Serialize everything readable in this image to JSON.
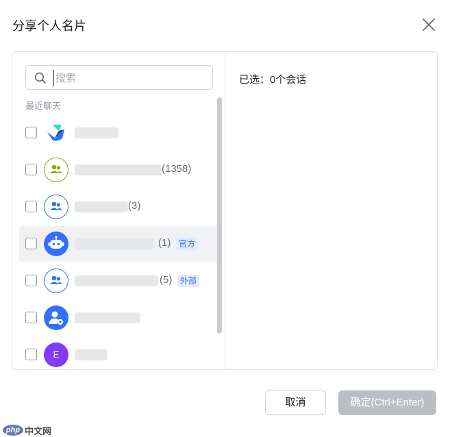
{
  "dialog": {
    "title": "分享个人名片",
    "close_icon": "close-icon"
  },
  "search": {
    "placeholder": "搜索",
    "value": "",
    "icon": "search-icon"
  },
  "recent": {
    "section_label": "最近聊天",
    "items": [
      {
        "avatar_icon": "app-logo-icon",
        "name": "",
        "count": "",
        "tag": ""
      },
      {
        "avatar_icon": "group-icon",
        "name": "",
        "count": "(1358)",
        "tag": ""
      },
      {
        "avatar_icon": "group-icon",
        "name": "",
        "count": "(3)",
        "tag": ""
      },
      {
        "avatar_icon": "bot-icon",
        "name": "",
        "count": "(1)",
        "tag": "官方"
      },
      {
        "avatar_icon": "group-icon",
        "name": "",
        "count": "(5)",
        "tag": "外部"
      },
      {
        "avatar_icon": "user-settings-icon",
        "name": "",
        "count": "",
        "tag": ""
      },
      {
        "avatar_icon": "letter-avatar",
        "avatar_letter": "E",
        "name": "",
        "count": "",
        "tag": ""
      }
    ]
  },
  "selection": {
    "label": "已选：0个会话"
  },
  "footer": {
    "cancel_label": "取消",
    "confirm_label": "确定(Ctrl+Enter)"
  },
  "watermark": {
    "logo_text": "php",
    "site_text": "中文网"
  },
  "colors": {
    "accent_blue": "#3370ff",
    "group_green": "#7cb305",
    "purple": "#7f3bf5",
    "confirm_disabled": "#bbbfc4"
  }
}
